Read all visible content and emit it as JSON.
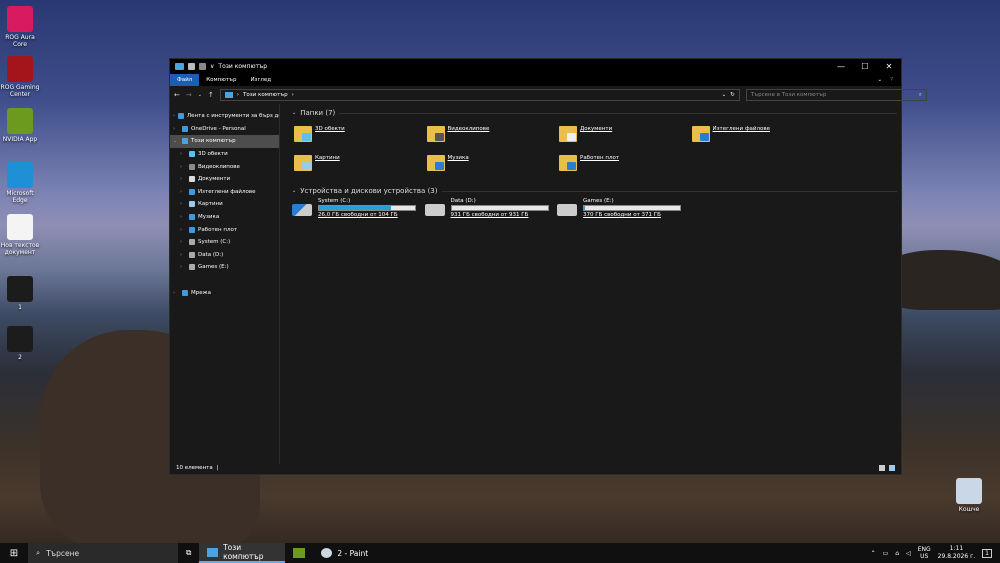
{
  "desktop": {
    "icons": [
      {
        "label": "ROG Aura Core",
        "color": "#d81b60"
      },
      {
        "label": "ROG Gaming Center",
        "color": "#a4151b"
      },
      {
        "label": "NVIDIA App",
        "color": "#6c9a1f"
      },
      {
        "label": "Microsoft Edge",
        "color": "#1f8fd6"
      },
      {
        "label": "Нов текстов документ",
        "color": "#f4f4f4"
      },
      {
        "label": "1",
        "color": "#1c1c1c"
      },
      {
        "label": "2",
        "color": "#1c1c1c"
      }
    ],
    "recycle_bin": {
      "label": "Кошче",
      "color": "#c9d7e6"
    }
  },
  "window": {
    "title": "Този компютър",
    "ribbon_tabs": [
      "Файл",
      "Компютър",
      "Изглед"
    ],
    "address": {
      "path": "Този компютър",
      "search_placeholder": "Търсене в Този компютър"
    },
    "sidebar": [
      {
        "label": "Лента с инструменти за бърз достъп",
        "icon": "star-icon",
        "color": "#3b9ae1",
        "level": 0,
        "chev": "›"
      },
      {
        "label": "OneDrive - Personal",
        "icon": "cloud-icon",
        "color": "#3b9ae1",
        "level": 0,
        "chev": "›"
      },
      {
        "label": "Този компютър",
        "icon": "computer-icon",
        "color": "#4aa3df",
        "level": 0,
        "chev": "⌄",
        "selected": true
      },
      {
        "label": "3D обекти",
        "icon": "cube-icon",
        "color": "#5bc0eb",
        "level": 1,
        "chev": "›"
      },
      {
        "label": "Видеоклипове",
        "icon": "video-icon",
        "color": "#8a8a8a",
        "level": 1,
        "chev": "›"
      },
      {
        "label": "Документи",
        "icon": "document-icon",
        "color": "#dcdcdc",
        "level": 1,
        "chev": "›"
      },
      {
        "label": "Изтеглени файлове",
        "icon": "download-icon",
        "color": "#3b9ae1",
        "level": 1,
        "chev": "›"
      },
      {
        "label": "Картини",
        "icon": "picture-icon",
        "color": "#9fc9e8",
        "level": 1,
        "chev": "›"
      },
      {
        "label": "Музика",
        "icon": "music-icon",
        "color": "#3b9ae1",
        "level": 1,
        "chev": "›"
      },
      {
        "label": "Работен плот",
        "icon": "desktop-icon",
        "color": "#3b9ae1",
        "level": 1,
        "chev": "›"
      },
      {
        "label": "System (C:)",
        "icon": "drive-icon",
        "color": "#aaaaaa",
        "level": 1,
        "chev": "›"
      },
      {
        "label": "Data (D:)",
        "icon": "drive-icon",
        "color": "#aaaaaa",
        "level": 1,
        "chev": "›"
      },
      {
        "label": "Games (E:)",
        "icon": "drive-icon",
        "color": "#aaaaaa",
        "level": 1,
        "chev": "›"
      },
      {
        "label": "",
        "spacer": true
      },
      {
        "label": "Мрежа",
        "icon": "network-icon",
        "color": "#3b9ae1",
        "level": 0,
        "chev": "›"
      }
    ],
    "folders_header": "Папки (7)",
    "folders": [
      {
        "label": "3D обекти",
        "badge": "#5bc0eb"
      },
      {
        "label": "Видеоклипове",
        "badge": "#555555"
      },
      {
        "label": "Документи",
        "badge": "#f0f0f0"
      },
      {
        "label": "Изтеглени файлове",
        "badge": "#2b7cd3"
      },
      {
        "label": "Картини",
        "badge": "#9fc9e8"
      },
      {
        "label": "Музика",
        "badge": "#2b7cd3"
      },
      {
        "label": "Работен плот",
        "badge": "#2b7cd3"
      }
    ],
    "drives_header": "Устройства и дискови устройства (3)",
    "drives": [
      {
        "name": "System (C:)",
        "free": "26,0 ГБ свободни от 104 ГБ",
        "used_fraction": 0.75
      },
      {
        "name": "Data (D:)",
        "free": "931 ГБ свободни от 931 ГБ",
        "used_fraction": 0.0
      },
      {
        "name": "Games (E:)",
        "free": "370 ГБ свободни от 371 ГБ",
        "used_fraction": 0.003
      }
    ],
    "status": "10 елемента"
  },
  "taskbar": {
    "search": "Търсене",
    "apps": [
      {
        "label": "Този компютър",
        "active": true
      },
      {
        "label": "",
        "active": false
      },
      {
        "label": "2 - Paint",
        "active": false
      }
    ],
    "lang_top": "ENG",
    "lang_bottom": "US",
    "time": "1:11",
    "date": "29.8.2026 г.",
    "notifications": "1"
  }
}
